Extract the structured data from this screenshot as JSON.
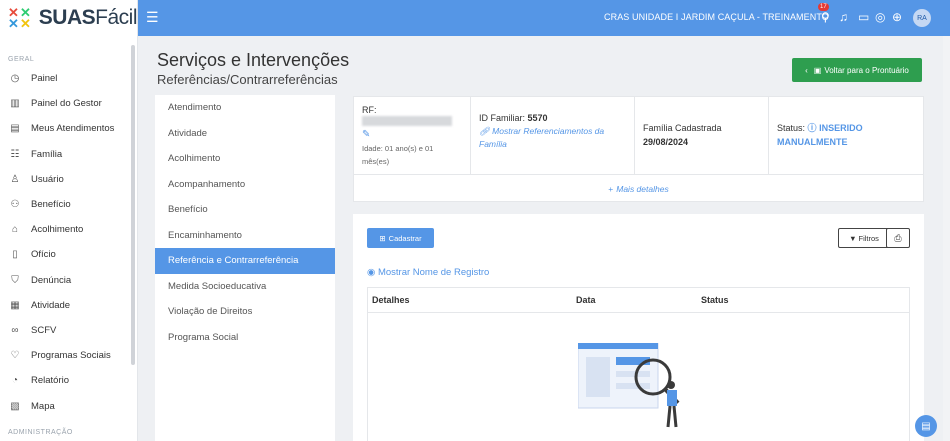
{
  "app": {
    "logo_prefix": "SUAS",
    "logo_suffix": "Fácil",
    "colors": {
      "primary": "#5596e6",
      "success": "#2e9e4f",
      "badge": "#e53935"
    }
  },
  "sidebar": {
    "section_general": "GERAL",
    "section_admin": "ADMINISTRAÇÃO",
    "items": [
      {
        "label": "Painel",
        "icon": "dashboard-icon"
      },
      {
        "label": "Painel do Gestor",
        "icon": "chart-icon"
      },
      {
        "label": "Meus Atendimentos",
        "icon": "id-card-icon"
      },
      {
        "label": "Família",
        "icon": "family-icon"
      },
      {
        "label": "Usuário",
        "icon": "user-icon"
      },
      {
        "label": "Benefício",
        "icon": "benefit-icon"
      },
      {
        "label": "Acolhimento",
        "icon": "shelter-icon"
      },
      {
        "label": "Ofício",
        "icon": "document-icon"
      },
      {
        "label": "Denúncia",
        "icon": "shield-icon"
      },
      {
        "label": "Atividade",
        "icon": "calendar-icon"
      },
      {
        "label": "SCFV",
        "icon": "link-icon"
      },
      {
        "label": "Programas Sociais",
        "icon": "hands-icon"
      },
      {
        "label": "Relatório",
        "icon": "pie-chart-icon"
      },
      {
        "label": "Mapa",
        "icon": "map-icon"
      }
    ]
  },
  "topbar": {
    "unit_name": "CRAS UNIDADE I JARDIM CAÇULA - TREINAMENTO",
    "notification_count": "17",
    "avatar_initials": "RA"
  },
  "page": {
    "title": "Serviços e Intervenções",
    "subtitle": "Referências/Contrarreferências",
    "back_button": "Voltar para o Prontuário"
  },
  "service_menu": {
    "items": [
      "Atendimento",
      "Atividade",
      "Acolhimento",
      "Acompanhamento",
      "Benefício",
      "Encaminhamento",
      "Referência e Contrarreferência",
      "Medida Socioeducativa",
      "Violação de Direitos",
      "Programa Social"
    ],
    "active_index": 6
  },
  "info": {
    "rf_label": "RF:",
    "age": "Idade: 01 ano(s) e 01 mês(es)",
    "id_familiar_label": "ID Familiar:",
    "id_familiar_value": "5570",
    "show_referrals_link": "Mostrar Referenciamentos da Família",
    "family_registered_label": "Família Cadastrada",
    "family_registered_date": "29/08/2024",
    "status_label": "Status:",
    "status_value": "INSERIDO MANUALMENTE",
    "more_details": "Mais detalhes"
  },
  "records": {
    "add_button": "Cadastrar",
    "filters_button": "Filtros",
    "show_name_link": "Mostrar Nome de Registro",
    "columns": [
      "Detalhes",
      "Data",
      "Status"
    ]
  }
}
